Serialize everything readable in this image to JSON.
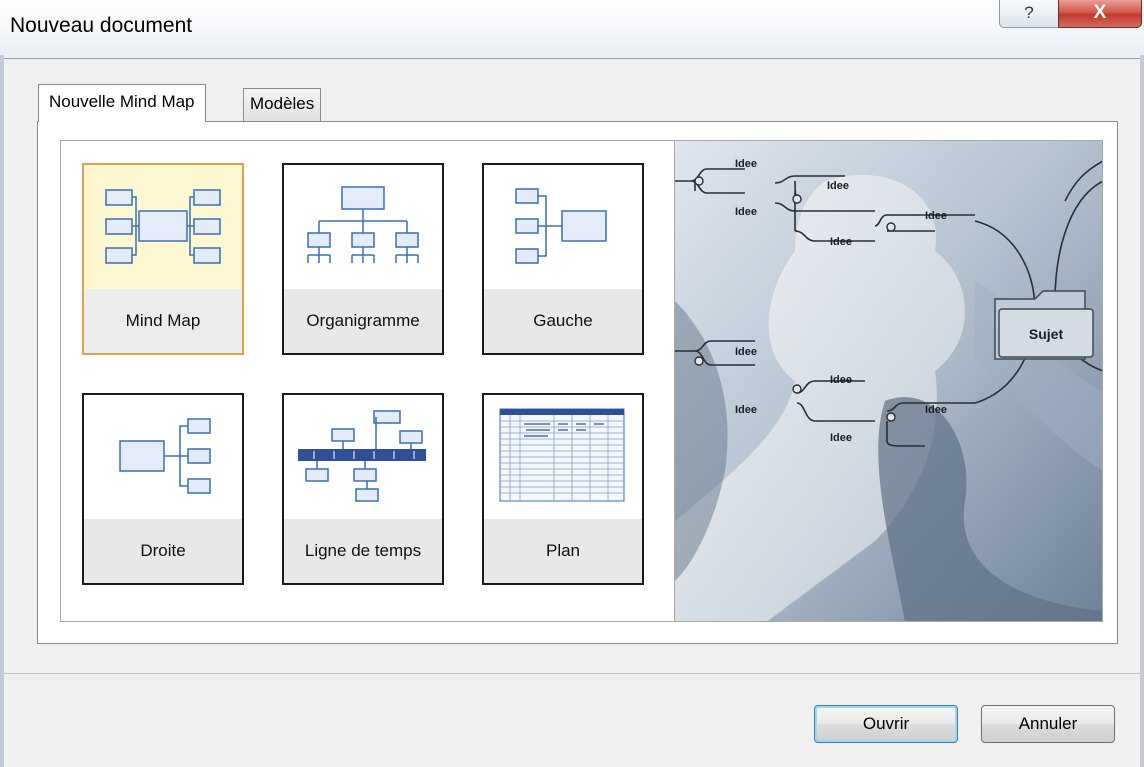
{
  "window": {
    "title": "Nouveau document",
    "help_glyph": "?",
    "close_glyph": "X"
  },
  "tabs": [
    {
      "label": "Nouvelle Mind Map",
      "active": true
    },
    {
      "label": "Modèles",
      "active": false
    }
  ],
  "templates": [
    {
      "label": "Mind Map",
      "icon": "mind-map-icon",
      "selected": true
    },
    {
      "label": "Organigramme",
      "icon": "org-chart-icon",
      "selected": false
    },
    {
      "label": "Gauche",
      "icon": "left-map-icon",
      "selected": false
    },
    {
      "label": "Droite",
      "icon": "right-map-icon",
      "selected": false
    },
    {
      "label": "Ligne de temps",
      "icon": "timeline-icon",
      "selected": false
    },
    {
      "label": "Plan",
      "icon": "outline-table-icon",
      "selected": false
    }
  ],
  "preview": {
    "central_topic": "Sujet",
    "idea_label": "Idee"
  },
  "buttons": {
    "open": "Ouvrir",
    "cancel": "Annuler"
  },
  "colors": {
    "selected_border": "#e0a050",
    "selected_fill": "#fdf7d2",
    "icon_blue": "#3a6fb5"
  }
}
